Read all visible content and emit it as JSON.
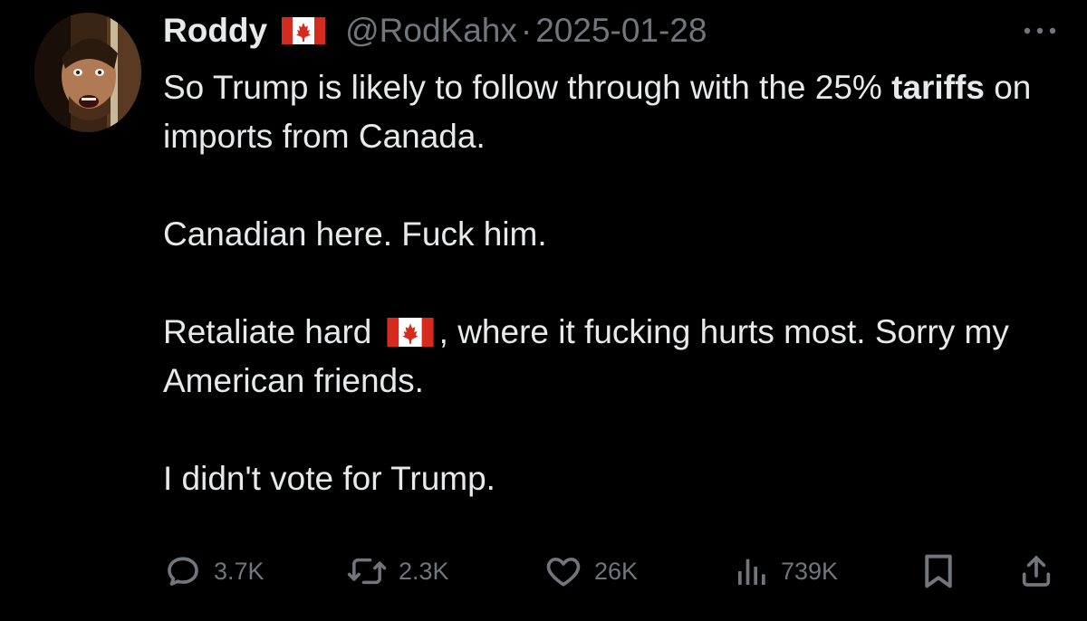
{
  "author": {
    "display_name": "Roddy",
    "name_emoji": "canadian-flag",
    "handle": "@RodKahx",
    "separator": "·",
    "date": "2025-01-28"
  },
  "tweet": {
    "line1_pre": "So Trump is likely to follow through with the 25% ",
    "line1_bold": "tariffs",
    "line1_post": " on imports from Canada.",
    "para2": "Canadian here. Fuck him.",
    "para3_pre": "Retaliate hard ",
    "para3_emoji": "canadian-flag",
    "para3_post": ", where it fucking hurts most. Sorry my American friends.",
    "para4": "I didn't vote for Trump."
  },
  "actions": {
    "replies": "3.7K",
    "reposts": "2.3K",
    "likes": "26K",
    "views": "739K"
  },
  "colors": {
    "background": "#000000",
    "text": "#e7e9ea",
    "muted": "#71767b",
    "flag_red": "#d52b1e"
  },
  "icons": [
    "more-icon",
    "reply-icon",
    "repost-icon",
    "like-icon",
    "views-icon",
    "bookmark-icon",
    "share-icon"
  ]
}
